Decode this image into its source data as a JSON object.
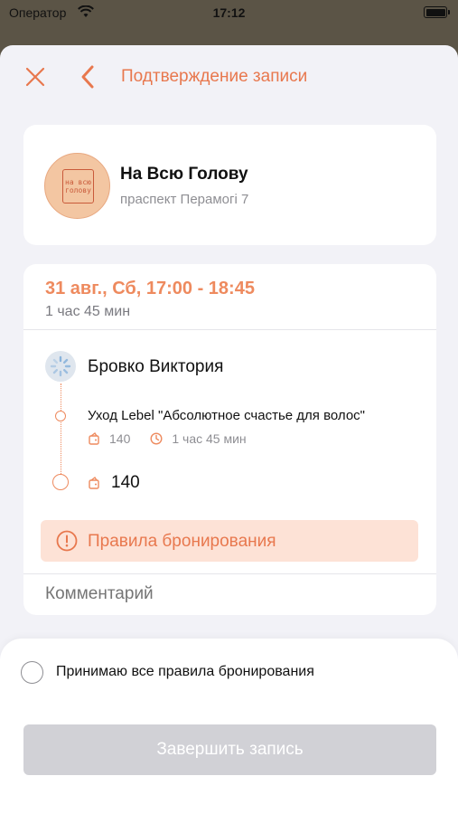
{
  "status_bar": {
    "carrier": "Оператор",
    "time": "17:12"
  },
  "nav": {
    "title": "Подтверждение записи"
  },
  "salon": {
    "logo_lines": [
      "на всю",
      "голову"
    ],
    "name": "На Всю Голову",
    "address": "праспект Перамогі 7"
  },
  "booking": {
    "datetime": "31 авг., Сб, 17:00 - 18:45",
    "duration": "1 час 45 мин",
    "master": {
      "name": "Бровко Виктория"
    },
    "service": {
      "name": "Уход Lebel \"Абсолютное счастье для волос\"",
      "price": "140",
      "duration": "1 час 45 мин"
    },
    "total": "140",
    "rules_label": "Правила бронирования",
    "comment_placeholder": "Комментарий"
  },
  "footer": {
    "accept_label": "Принимаю все правила бронирования",
    "submit_label": "Завершить запись"
  },
  "colors": {
    "accent": "#e8784e",
    "accent_light": "#fde2d6",
    "disabled_button": "#d1d1d6"
  }
}
